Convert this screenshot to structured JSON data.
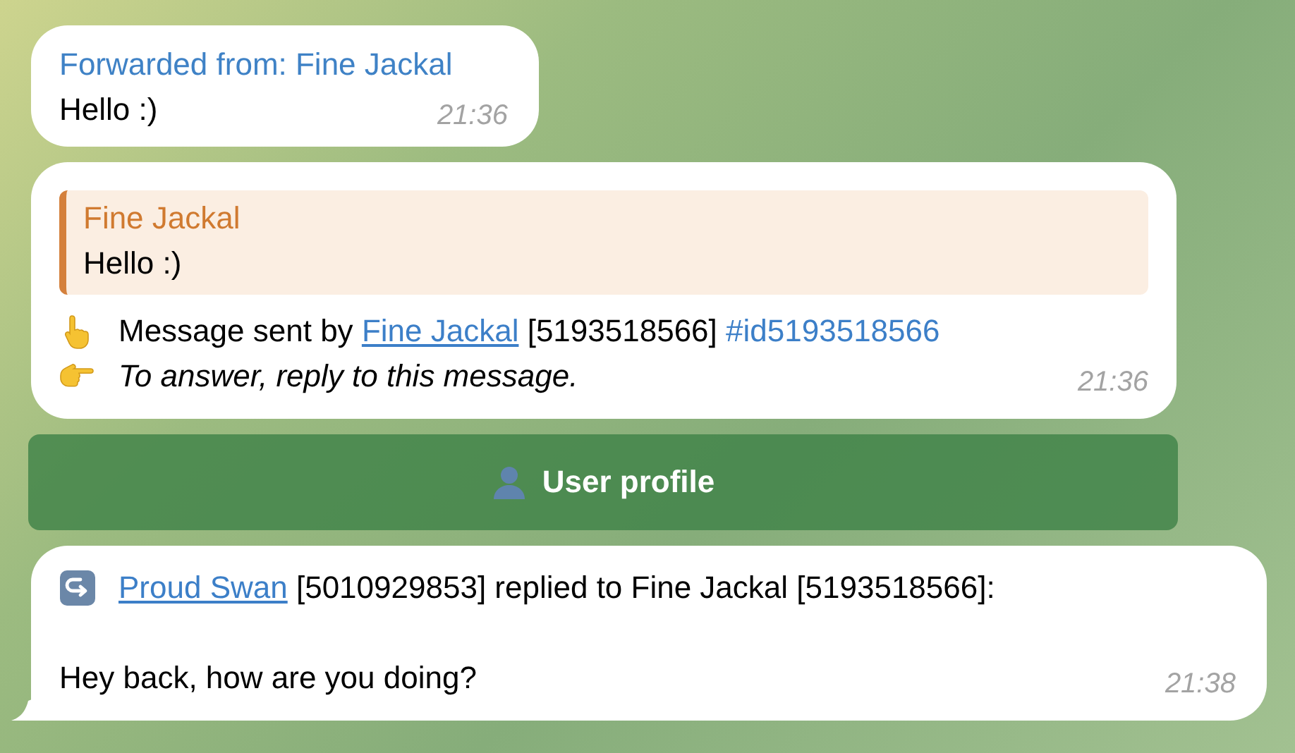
{
  "messages": [
    {
      "kind": "forward",
      "header": "Forwarded from: Fine Jackal",
      "text": "Hello :)",
      "time": "21:36",
      "tail": false
    },
    {
      "kind": "info",
      "quote": {
        "author": "Fine Jackal",
        "text": "Hello :)"
      },
      "lines": [
        {
          "kind": "sent-by",
          "parts": [
            {
              "kind": "text",
              "text": "Message sent by "
            },
            {
              "kind": "link",
              "text": "Fine Jackal"
            },
            {
              "kind": "text",
              "text": " [5193518566] "
            },
            {
              "kind": "hashtag",
              "text": "#id5193518566"
            }
          ]
        },
        {
          "kind": "answer-hint",
          "parts": [
            {
              "kind": "italic",
              "text": "To answer, reply to this message."
            }
          ]
        }
      ],
      "time": "21:36",
      "tail": false
    },
    {
      "kind": "button",
      "label": "User profile"
    },
    {
      "kind": "info",
      "lines": [
        {
          "kind": "reply-header",
          "parts": [
            {
              "kind": "link",
              "text": "Proud Swan"
            },
            {
              "kind": "text",
              "text": " [5010929853] replied to Fine Jackal [5193518566]:"
            }
          ]
        },
        {
          "kind": "blank"
        },
        {
          "kind": "body",
          "parts": [
            {
              "kind": "text",
              "text": "Hey back, how are you doing?"
            }
          ]
        }
      ],
      "time": "21:38",
      "tail": true
    }
  ]
}
